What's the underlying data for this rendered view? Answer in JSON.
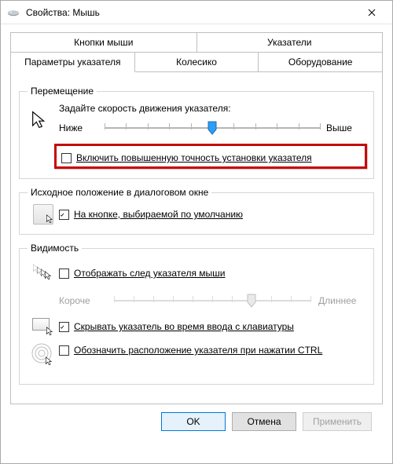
{
  "window": {
    "title": "Свойства: Мышь"
  },
  "tabs": {
    "row1": [
      "Кнопки мыши",
      "Указатели"
    ],
    "row2": [
      "Параметры указателя",
      "Колесико",
      "Оборудование"
    ],
    "active": "Параметры указателя"
  },
  "groups": {
    "movement": {
      "legend": "Перемещение",
      "speed_label": "Задайте скорость движения указателя:",
      "slow": "Ниже",
      "fast": "Выше",
      "slider": {
        "min": 0,
        "max": 10,
        "value": 5,
        "enabled": true
      },
      "precision_label": "Включить повышенную точность установки указателя",
      "precision_checked": false
    },
    "snap": {
      "legend": "Исходное положение в диалоговом окне",
      "label": "На кнопке, выбираемой по умолчанию",
      "checked": true
    },
    "visibility": {
      "legend": "Видимость",
      "trail_label": "Отображать след указателя мыши",
      "trail_checked": false,
      "trail_short": "Короче",
      "trail_long": "Длиннее",
      "trail_slider": {
        "min": 0,
        "max": 10,
        "value": 7,
        "enabled": false
      },
      "hide_typing_label": "Скрывать указатель во время ввода с клавиатуры",
      "hide_typing_checked": true,
      "ctrl_locate_label": "Обозначить расположение указателя при нажатии CTRL",
      "ctrl_locate_checked": false
    }
  },
  "buttons": {
    "ok": "OK",
    "cancel": "Отмена",
    "apply": "Применить"
  }
}
